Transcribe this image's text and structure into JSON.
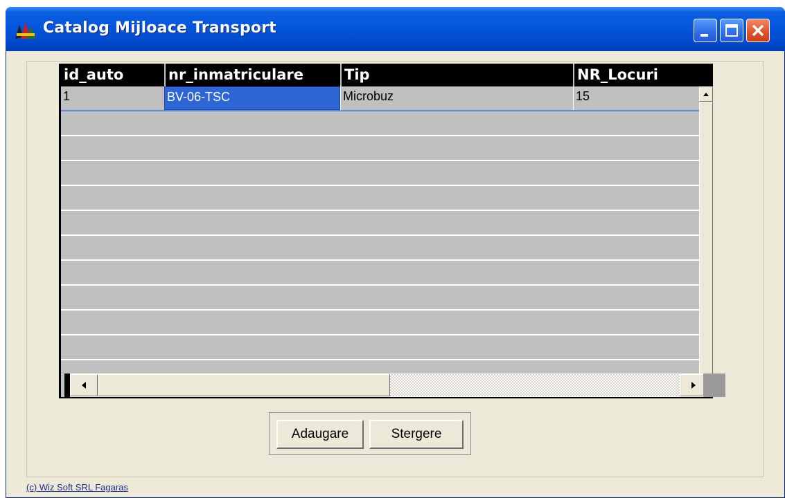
{
  "window": {
    "title": "Catalog Mijloace Transport",
    "controls": [
      "minimize-icon",
      "maximize-icon",
      "close-icon"
    ]
  },
  "grid": {
    "columns": [
      "id_auto",
      "nr_inmatriculare",
      "Tip",
      "NR_Locuri"
    ],
    "rows": [
      [
        "1",
        "BV-06-TSC",
        "Microbuz",
        "15"
      ]
    ],
    "selected_cell": "BV-06-TSC"
  },
  "buttons": {
    "add_label": "Adaugare",
    "delete_label": "Stergere"
  },
  "footer": {
    "copyright": "(c) Wiz Soft SRL Fagaras"
  },
  "colors": {
    "titlebar": "#0454dc",
    "selection": "#2f66d6",
    "grid_bg": "#c0c0c0",
    "header_bg": "#000000"
  }
}
